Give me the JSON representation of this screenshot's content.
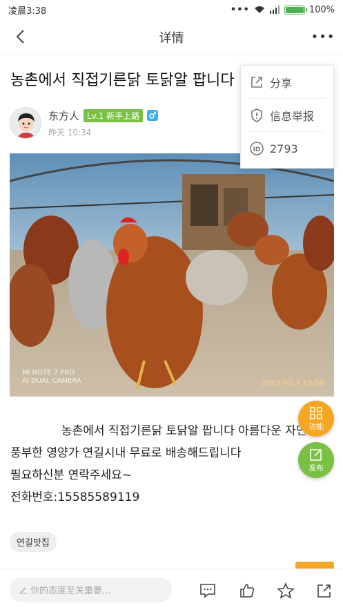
{
  "status_bar": {
    "time": "凌晨3:38",
    "battery": "100%"
  },
  "nav": {
    "title": "详情"
  },
  "post": {
    "title": "농촌에서 직접기른닭 토닭알 팝니다",
    "author": {
      "name": "东方人",
      "level": "Lv.1 新手上路",
      "time": "昨天 10:34"
    },
    "photo": {
      "watermark_line1": "MI NOTE 7 PRO",
      "watermark_line2": "AI DUAL CAMERA",
      "date": "2019/9/13 10:56"
    },
    "content": {
      "line1": "농촌에서 직접기른닭 토닭알 팝니다 아름다운 자연",
      "line2": "풍부한 영양가 연길시내 무료로 배송해드립니다",
      "line3": "필요하신분 연락주세요~",
      "line4": "전화번호:15585589119"
    },
    "tag": "연길맛집"
  },
  "menu": {
    "items": [
      {
        "label": "分享",
        "icon": "share-icon"
      },
      {
        "label": "信息举报",
        "icon": "report-shield-icon"
      },
      {
        "label": "2793",
        "icon": "id-icon"
      }
    ]
  },
  "fabs": {
    "function": "功能",
    "publish": "发布"
  },
  "bottom_bar": {
    "comment_placeholder": "你的态度至关重要..."
  }
}
